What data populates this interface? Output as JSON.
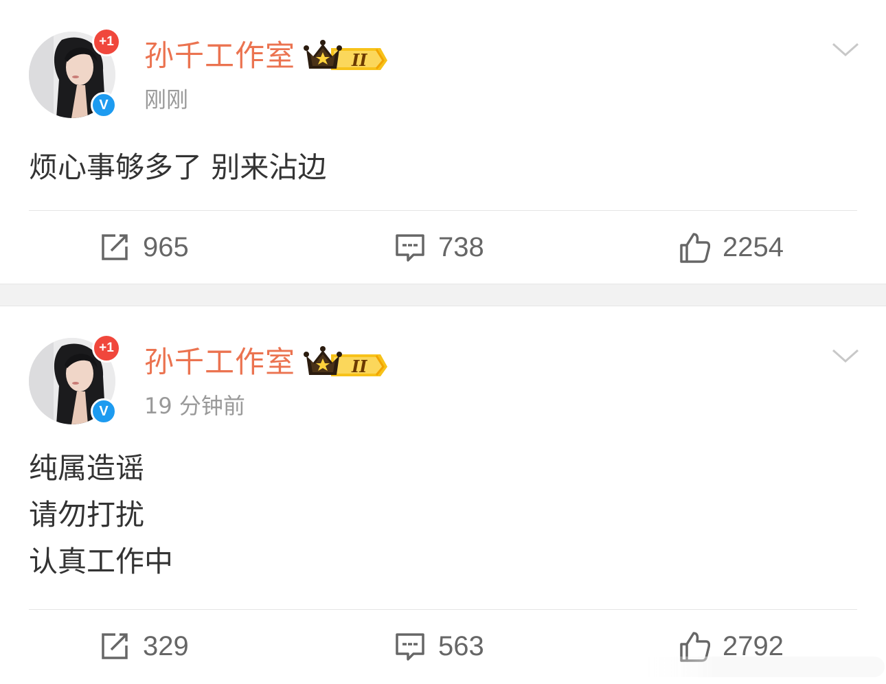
{
  "posts": [
    {
      "author": "孙千工作室",
      "badge_plus": "+1",
      "verified_mark": "V",
      "member_level": "II",
      "time": "刚刚",
      "content_lines": [
        "烦心事够多了 别来沾边"
      ],
      "repost_count": "965",
      "comment_count": "738",
      "like_count": "2254"
    },
    {
      "author": "孙千工作室",
      "badge_plus": "+1",
      "verified_mark": "V",
      "member_level": "II",
      "time": "19 分钟前",
      "content_lines": [
        "纯属造谣",
        "请勿打扰",
        "认真工作中"
      ],
      "repost_count": "329",
      "comment_count": "563",
      "like_count": "2792"
    }
  ],
  "icons": {
    "repost": "repost-icon",
    "comment": "comment-icon",
    "like": "thumbs-up-icon",
    "more": "chevron-down-icon",
    "crown": "crown-icon"
  },
  "colors": {
    "author_name": "#eb7350",
    "secondary_text": "#999999",
    "badge_plus": "#f0473c",
    "verified": "#1d9bf0",
    "crown_gold": "#f5b800"
  }
}
